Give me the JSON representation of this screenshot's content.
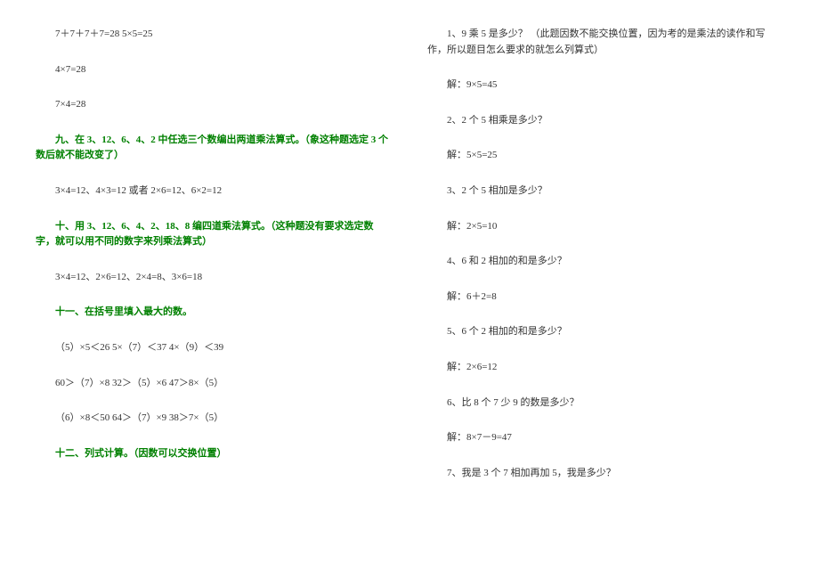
{
  "left": {
    "l1": "7＋7＋7＋7=28 5×5=25",
    "l2": "4×7=28",
    "l3": "7×4=28",
    "h9": "九、在 3、12、6、4、2 中任选三个数编出两道乘法算式。（象这种题选定 3 个数后就不能改变了）",
    "l4": "3×4=12、4×3=12 或者 2×6=12、6×2=12",
    "h10": "十、用 3、12、6、4、2、18、8 编四道乘法算式。（这种题没有要求选定数字，就可以用不同的数字来列乘法算式）",
    "l5": "3×4=12、2×6=12、2×4=8、3×6=18",
    "h11": "十一、在括号里填入最大的数。",
    "l6": "（5）×5＜26 5×（7）＜37 4×（9）＜39",
    "l7": "60＞（7）×8 32＞（5）×6 47＞8×（5）",
    "l8": "（6）×8＜50 64＞（7）×9 38＞7×（5）",
    "h12": "十二、列式计算。（因数可以交换位置）"
  },
  "right": {
    "l1": "1、9 乘 5 是多少？ （此题因数不能交换位置，因为考的是乘法的读作和写作，所以题目怎么要求的就怎么列算式）",
    "l2": "解：9×5=45",
    "l3": "2、2 个 5 相乘是多少？",
    "l4": "解：5×5=25",
    "l5": "3、2 个 5 相加是多少？",
    "l6": "解：2×5=10",
    "l7": "4、6 和 2 相加的和是多少？",
    "l8": "解：6＋2=8",
    "l9": "5、6 个 2 相加的和是多少？",
    "l10": "解：2×6=12",
    "l11": "6、比 8 个 7 少 9 的数是多少？",
    "l12": "解：8×7－9=47",
    "l13": "7、我是 3 个 7 相加再加 5，我是多少？"
  }
}
